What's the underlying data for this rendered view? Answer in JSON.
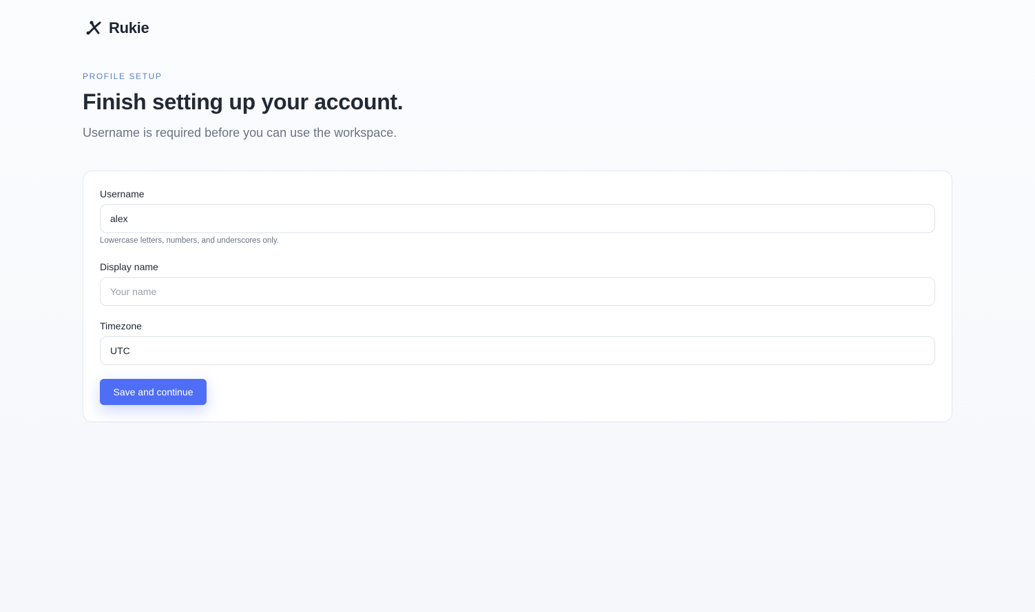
{
  "brand": {
    "name": "Rukie",
    "logo_icon": "rukie-logo-icon"
  },
  "header": {
    "eyebrow": "PROFILE SETUP",
    "title": "Finish setting up your account.",
    "subtitle": "Username is required before you can use the workspace."
  },
  "form": {
    "username": {
      "label": "Username",
      "value": "alex",
      "hint": "Lowercase letters, numbers, and underscores only."
    },
    "display_name": {
      "label": "Display name",
      "value": "",
      "placeholder": "Your name"
    },
    "timezone": {
      "label": "Timezone",
      "value": "UTC"
    },
    "submit_label": "Save and continue"
  },
  "colors": {
    "accent": "#4f6ef7",
    "eyebrow": "#5b7fc4",
    "background": "#f8f9fc"
  }
}
